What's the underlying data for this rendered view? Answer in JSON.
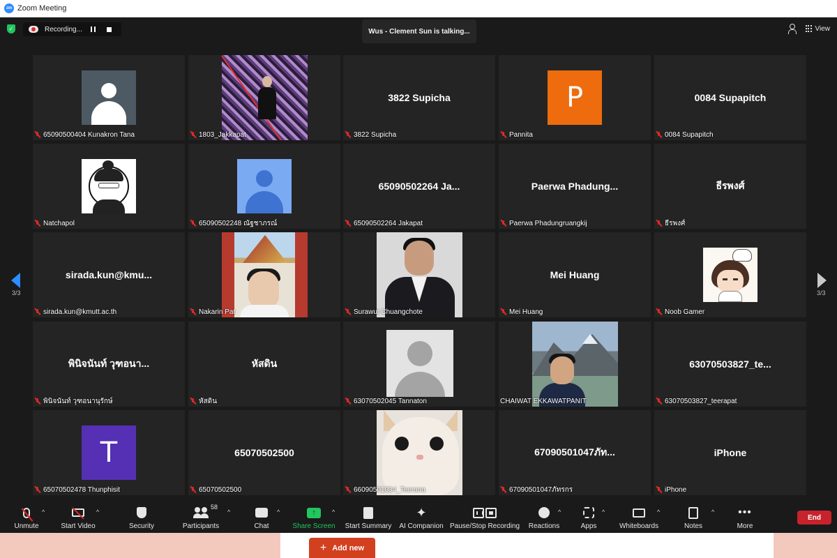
{
  "window": {
    "title": "Zoom Meeting"
  },
  "header": {
    "recording_label": "Recording...",
    "talking_label": "Wus - Clement Sun is talking...",
    "view_label": "View"
  },
  "pagination": {
    "left": "3/3",
    "right": "3/3"
  },
  "tiles": [
    {
      "display": "65090500404 Kunakron Tana"
    },
    {
      "display": "1803_Jakkapat"
    },
    {
      "center": "3822 Supicha",
      "display": "3822 Supicha"
    },
    {
      "letter": "P",
      "display": "Pannita"
    },
    {
      "center": "0084 Supapitch",
      "display": "0084 Supapitch"
    },
    {
      "display": "Natchapol"
    },
    {
      "display": "65090502248 ณัฐชาภรณ์"
    },
    {
      "center": "65090502264 Ja...",
      "display": "65090502264 Jakapat"
    },
    {
      "center": "Paerwa Phadung...",
      "display": "Paerwa Phadungruangkij"
    },
    {
      "center": "ธีรพงศ์",
      "display": "ธีรพงศ์"
    },
    {
      "center": "sirada.kun@kmu...",
      "display": "sirada.kun@kmutt.ac.th"
    },
    {
      "display": "Nakarin Pat"
    },
    {
      "display": "Surawut Chuangchote"
    },
    {
      "center": "Mei Huang",
      "display": "Mei Huang"
    },
    {
      "display": "Noob Gamer"
    },
    {
      "center": "พินิจนันท์ วุฑอนา...",
      "display": "พินิจนันท์ วุฑอนานุรักษ์"
    },
    {
      "center": "หัสดิน",
      "display": "หัสดิน"
    },
    {
      "display": "63070502045 Tannaton"
    },
    {
      "display": "CHAIWAT EKKAWATPANIT"
    },
    {
      "center": "63070503827_te...",
      "display": "63070503827_teerapat"
    },
    {
      "letter": "T",
      "display": "65070502478 Thunphisit"
    },
    {
      "center": "65070502500",
      "display": "65070502500"
    },
    {
      "display": "66090501034_Teerana"
    },
    {
      "center": "67090501047ภัท...",
      "display": "67090501047ภัทรกร"
    },
    {
      "center": "iPhone",
      "display": "iPhone"
    }
  ],
  "toolbar": {
    "unmute": "Unmute",
    "start_video": "Start Video",
    "security": "Security",
    "participants": "Participants",
    "participants_count": "58",
    "chat": "Chat",
    "share_screen": "Share Screen",
    "start_summary": "Start Summary",
    "ai_companion": "AI Companion",
    "pause_stop_recording": "Pause/Stop Recording",
    "reactions": "Reactions",
    "apps": "Apps",
    "whiteboards": "Whiteboards",
    "notes": "Notes",
    "more": "More",
    "end": "End"
  },
  "background_page": {
    "add_new": "Add new"
  },
  "colors": {
    "zoom_blue": "#2d8cff",
    "share_green": "#22c55e",
    "end_red": "#c8232c",
    "tile_bg": "#242424",
    "avatar_orange": "#ee6c0e",
    "avatar_purple": "#5530b4",
    "add_new_orange": "#d2401f"
  }
}
